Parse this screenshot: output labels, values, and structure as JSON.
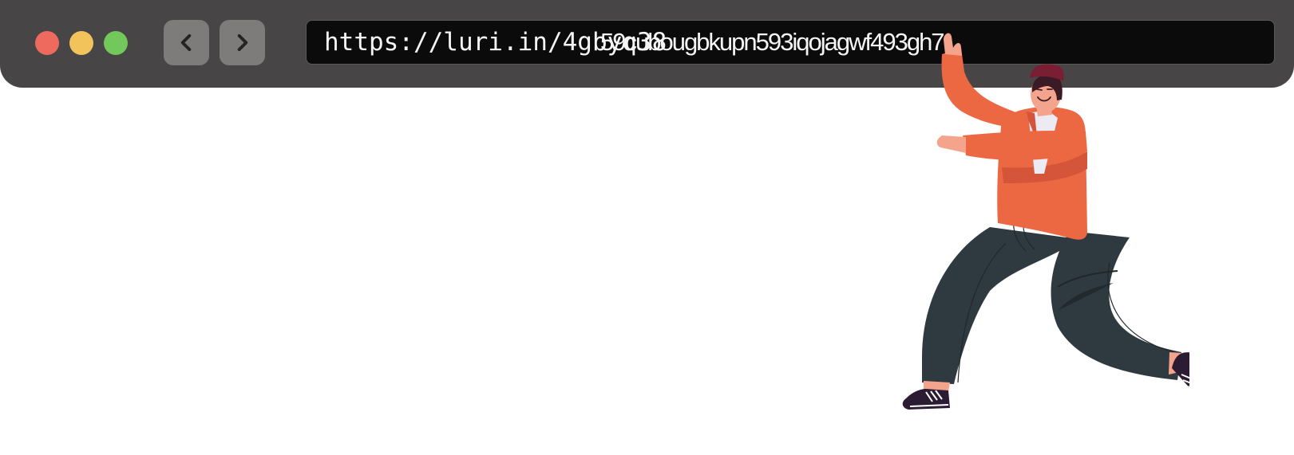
{
  "window": {
    "controls": {
      "close_color": "#ee6a5f",
      "minimize_color": "#f2c25b",
      "zoom_color": "#72c85a"
    }
  },
  "toolbar": {
    "back_icon": "chevron-left-icon",
    "forward_icon": "chevron-right-icon"
  },
  "address_bar": {
    "url": "https://luri.in/4gbyq38",
    "overlay_text": "59cubougbkupn593iqojagwf493gh7"
  },
  "illustration": {
    "subject": "person-waving-illustration",
    "colors": {
      "sweater": "#ec6843",
      "pants": "#2f3a40",
      "skin": "#f4a48c",
      "hat": "#7a1f33",
      "shoes": "#2b1c33"
    }
  }
}
